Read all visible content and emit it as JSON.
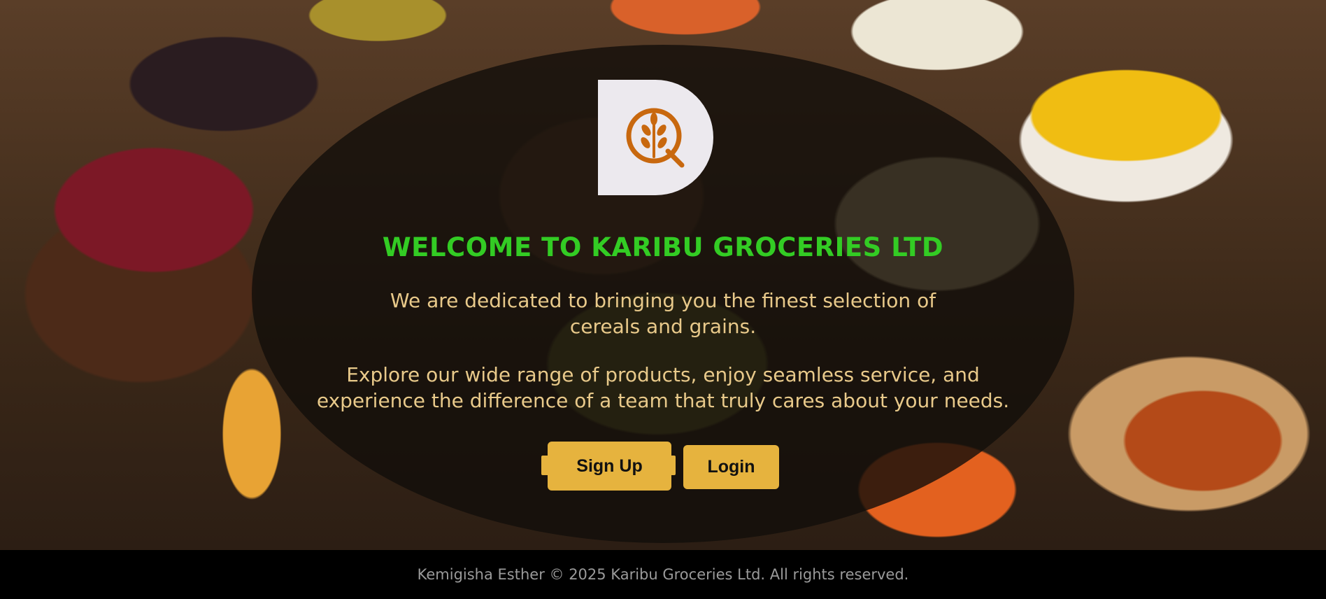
{
  "brand": {
    "logo_icon": "grain-leaf-logo-icon",
    "accent": "#c8680e"
  },
  "hero": {
    "title": "WELCOME TO KARIBU GROCERIES LTD",
    "line1": "We are dedicated to bringing you the finest selection of cereals and grains.",
    "line2": "Explore our wide range of products, enjoy seamless service, and experience the difference of a team that truly cares about your needs.",
    "title_color": "#33cc24",
    "text_color": "#e8c98a"
  },
  "buttons": {
    "signup": "Sign Up",
    "login": "Login",
    "color": "#e6b33e"
  },
  "footer": {
    "text": "Kemigisha Esther © 2025 Karibu Groceries Ltd. All rights reserved."
  }
}
